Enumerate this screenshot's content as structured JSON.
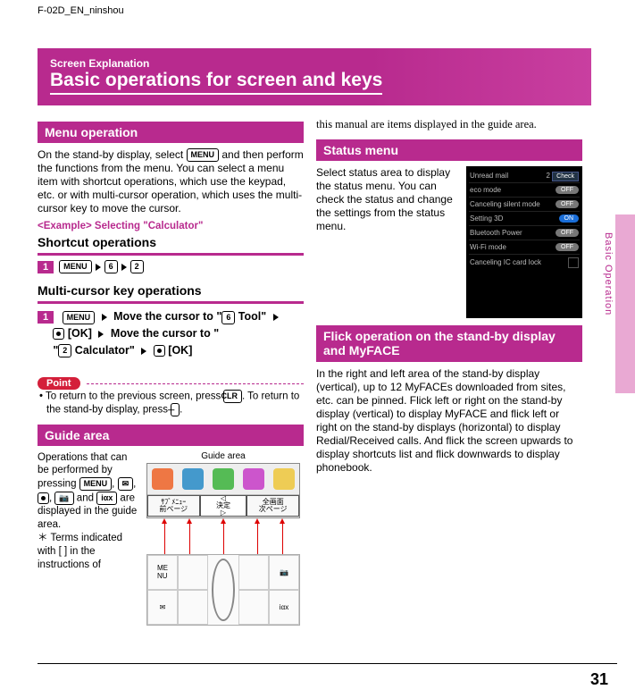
{
  "header_label": "F-02D_EN_ninshou",
  "banner": {
    "small": "Screen Explanation",
    "big": "Basic operations for screen and keys"
  },
  "left": {
    "menu_op_title": "Menu operation",
    "menu_op_text": "On the stand-by display, select MENU and then perform the functions from the menu. You can select a menu item with shortcut operations, which use the keypad, etc. or with multi-cursor operation, which uses the multi-cursor key to move the cursor.",
    "example_label": "<Example>   Selecting \"Calculator\"",
    "shortcut_head": "Shortcut operations",
    "step1_keys": [
      "MENU",
      "6",
      "2"
    ],
    "multi_head": "Multi-cursor key operations",
    "step2_prefix": "MENU",
    "step2_a": "Move the cursor to \"",
    "step2_tool_key": "6",
    "step2_tool_suffix": " Tool\"",
    "step2_ok1": " [OK]",
    "step2_b": "Move the cursor to \"",
    "step2_calc_key": "2",
    "step2_calc_suffix": " Calculator\"",
    "step2_ok2": " [OK]",
    "point_label": "Point",
    "point_text_a": "To return to the previous screen, press ",
    "point_clr": "CLR",
    "point_text_b": ". To return to the stand-by display, press ",
    "point_end": "⏤",
    "point_text_c": ".",
    "guide_title": "Guide area",
    "guide_label_small": "Guide area",
    "guide_left_a": "Operations that can be performed by pressing ",
    "guide_keys": [
      "MENU",
      "✉",
      "●",
      "📷",
      "iαx"
    ],
    "guide_left_b": " are displayed in the guide area.",
    "guide_foot": "＊  Terms indicated with [ ] in the instructions of",
    "softkeys": {
      "l1": "ｻﾌﾞﾒﾆｭｰ",
      "l2": "前ページ",
      "m": "決定",
      "r1": "全画面",
      "r2": "次ページ"
    },
    "keypad": {
      "tl": "ME\nNU",
      "bl": "✉",
      "tr": "📷",
      "br": "iαx"
    }
  },
  "right": {
    "cont_text": "this manual are items displayed in the guide area.",
    "status_title": "Status menu",
    "status_text": "Select status area to display the status menu. You can check the status and change the settings from the status menu.",
    "status_rows": [
      {
        "label": "Unread mail",
        "value": "2",
        "btn": "Check",
        "type": "btn"
      },
      {
        "label": "eco mode",
        "value": "OFF",
        "type": "off"
      },
      {
        "label": "Canceling silent mode",
        "value": "OFF",
        "type": "off"
      },
      {
        "label": "Setting 3D",
        "value": "ON",
        "type": "on"
      },
      {
        "label": "Bluetooth Power",
        "value": "OFF",
        "type": "off"
      },
      {
        "label": "Wi-Fi mode",
        "value": "OFF",
        "type": "off"
      },
      {
        "label": "Canceling IC card lock",
        "value": "",
        "type": "none"
      }
    ],
    "flick_title": "Flick operation on the stand-by display and MyFACE",
    "flick_text": "In the right and left area of the stand-by display (vertical), up to 12 MyFACEs downloaded from sites, etc. can be pinned. Flick left or right on the stand-by display (vertical) to display MyFACE and flick left or right on the stand-by displays (horizontal) to display Redial/Received calls. And flick the screen upwards to display shortcuts list and flick downwards to display phonebook."
  },
  "side_tab": "Basic Operation",
  "page_num": "31"
}
